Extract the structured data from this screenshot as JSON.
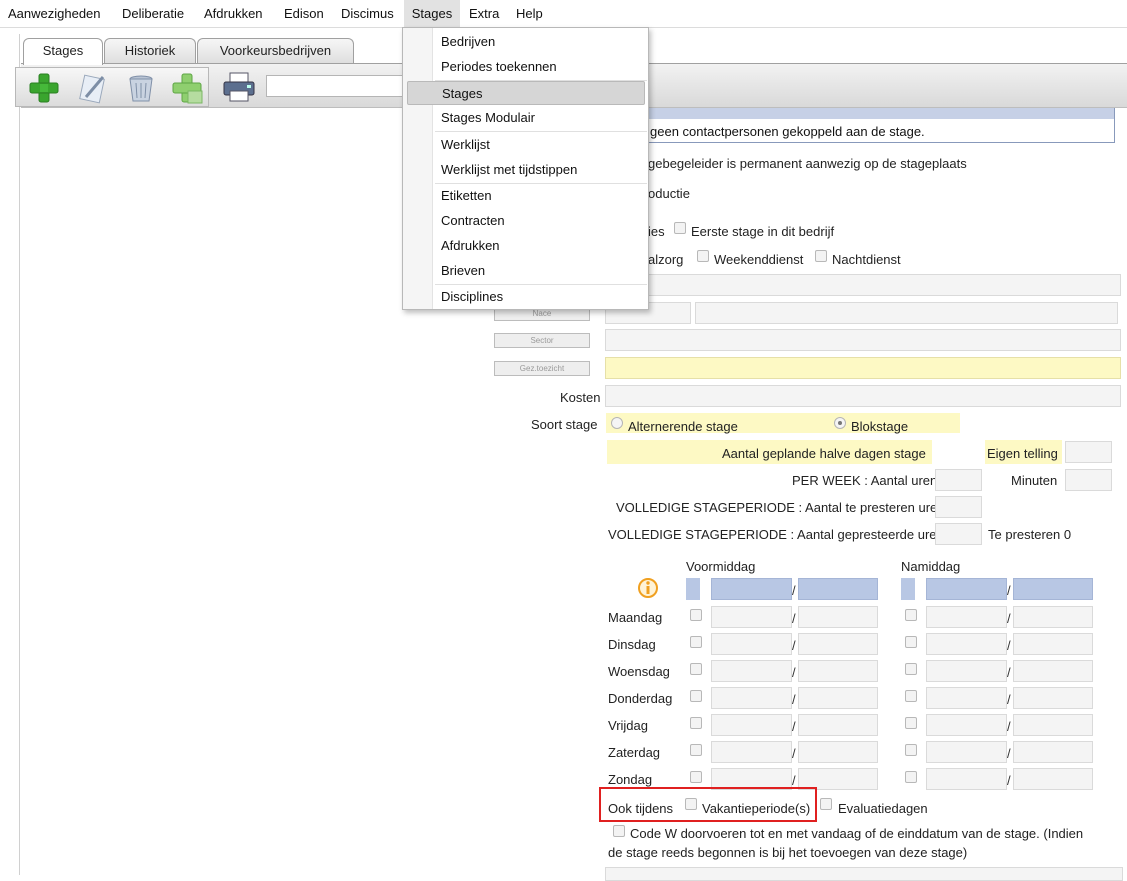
{
  "menubar": {
    "items": [
      "Aanwezigheden",
      "Deliberatie",
      "Afdrukken",
      "Edison",
      "Discimus",
      "Stages",
      "Extra",
      "Help"
    ],
    "active": "Stages"
  },
  "tabs": [
    "Stages",
    "Historiek",
    "Voorkeursbedrijven"
  ],
  "toolbar": {
    "icons": [
      "add-icon",
      "edit-icon",
      "delete-icon",
      "add-secondary-icon",
      "print-icon"
    ],
    "search_value": ""
  },
  "dropdown": {
    "items": [
      "Bedrijven",
      "Periodes toekennen",
      "Stages",
      "Stages Modulair",
      "Werklijst",
      "Werklijst met tijdstippen",
      "Etiketten",
      "Contracten",
      "Afdrukken",
      "Brieven",
      "Disciplines"
    ],
    "selected": "Stages"
  },
  "contacts_table": {
    "empty_text": "geen contactpersonen gekoppeld aan de stage."
  },
  "form": {
    "permanent_text": "gebegeleider is permanent aanwezig op de stageplaats",
    "productie_text": "oductie",
    "ies_text": "ies",
    "eerste_stage": "Eerste stage in dit bedrijf",
    "alzorg_text": "alzorg",
    "weekenddienst": "Weekenddienst",
    "nachtdienst": "Nachtdienst",
    "btn_nace": "Nace",
    "btn_sector": "Sector",
    "btn_toezicht": "Gez.toezicht",
    "kosten": "Kosten",
    "soort_stage": "Soort stage",
    "alternerende": "Alternerende stage",
    "blokstage": "Blokstage",
    "halve_dagen": "Aantal geplande halve dagen stage",
    "eigen_telling": "Eigen telling",
    "per_week": "PER WEEK : Aantal uren",
    "minuten": "Minuten",
    "volledige_te_presteren": "VOLLEDIGE STAGEPERIODE : Aantal te presteren uren",
    "volledige_gepresteerd": "VOLLEDIGE STAGEPERIODE : Aantal gepresteerde uren",
    "te_presteren": "Te presteren 0"
  },
  "schedule": {
    "voormiddag": "Voormiddag",
    "namiddag": "Namiddag",
    "info_icon": "info-icon",
    "days": [
      "Maandag",
      "Dinsdag",
      "Woensdag",
      "Donderdag",
      "Vrijdag",
      "Zaterdag",
      "Zondag"
    ],
    "separator": "/"
  },
  "options": {
    "ook_tijdens": "Ook tijdens",
    "vakantieperiode": "Vakantieperiode(s)",
    "evaluatiedagen": "Evaluatiedagen",
    "code_w_line1": "Code W doorvoeren tot en met vandaag of de einddatum van de stage. (Indien",
    "code_w_line2": "de stage reeds begonnen is bij het toevoegen van deze stage)"
  },
  "colors": {
    "accent_blue": "#b8c7e4",
    "highlight_yellow": "#fdf9c4",
    "annotation_red": "#e02020"
  }
}
